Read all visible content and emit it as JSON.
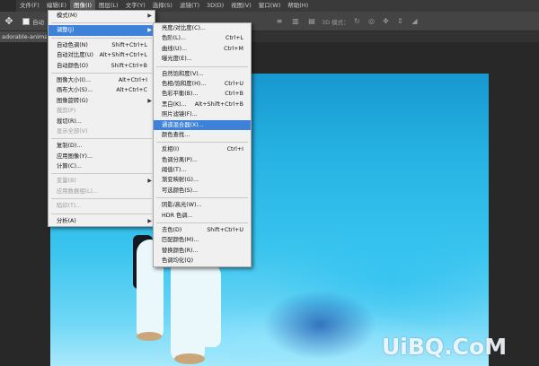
{
  "menubar": {
    "items": [
      "文件(F)",
      "编辑(E)",
      "图像(I)",
      "图层(L)",
      "文字(Y)",
      "选择(S)",
      "滤镜(T)",
      "3D(D)",
      "视图(V)",
      "窗口(W)",
      "帮助(H)"
    ]
  },
  "optbar": {
    "checkbox_label": "自动",
    "mode_label": "3D 模式："
  },
  "document": {
    "tab_title": "adorable-animal-"
  },
  "image_menu": {
    "items": [
      {
        "label": "模式(M)",
        "shortcut": "",
        "submenu": true,
        "disabled": false
      },
      {
        "sep": true
      },
      {
        "label": "调整(J)",
        "shortcut": "",
        "submenu": true,
        "disabled": false,
        "highlighted": true
      },
      {
        "sep": true
      },
      {
        "label": "自动色调(N)",
        "shortcut": "Shift+Ctrl+L",
        "disabled": false
      },
      {
        "label": "自动对比度(U)",
        "shortcut": "Alt+Shift+Ctrl+L",
        "disabled": false
      },
      {
        "label": "自动颜色(O)",
        "shortcut": "Shift+Ctrl+B",
        "disabled": false
      },
      {
        "sep": true
      },
      {
        "label": "图像大小(I)...",
        "shortcut": "Alt+Ctrl+I",
        "disabled": false
      },
      {
        "label": "画布大小(S)...",
        "shortcut": "Alt+Ctrl+C",
        "disabled": false
      },
      {
        "label": "图像旋转(G)",
        "shortcut": "",
        "submenu": true,
        "disabled": false
      },
      {
        "label": "裁剪(P)",
        "shortcut": "",
        "disabled": true
      },
      {
        "label": "裁切(R)...",
        "shortcut": "",
        "disabled": false
      },
      {
        "label": "显示全部(V)",
        "shortcut": "",
        "disabled": true
      },
      {
        "sep": true
      },
      {
        "label": "复制(D)...",
        "shortcut": "",
        "disabled": false
      },
      {
        "label": "应用图像(Y)...",
        "shortcut": "",
        "disabled": false
      },
      {
        "label": "计算(C)...",
        "shortcut": "",
        "disabled": false
      },
      {
        "sep": true
      },
      {
        "label": "变量(B)",
        "shortcut": "",
        "submenu": true,
        "disabled": true
      },
      {
        "label": "应用数据组(L)...",
        "shortcut": "",
        "disabled": true
      },
      {
        "sep": true
      },
      {
        "label": "陷印(T)...",
        "shortcut": "",
        "disabled": true
      },
      {
        "sep": true
      },
      {
        "label": "分析(A)",
        "shortcut": "",
        "submenu": true,
        "disabled": false
      }
    ]
  },
  "adjust_menu": {
    "items": [
      {
        "label": "亮度/对比度(C)...",
        "shortcut": ""
      },
      {
        "label": "色阶(L)...",
        "shortcut": "Ctrl+L"
      },
      {
        "label": "曲线(U)...",
        "shortcut": "Ctrl+M"
      },
      {
        "label": "曝光度(E)...",
        "shortcut": ""
      },
      {
        "sep": true
      },
      {
        "label": "自然饱和度(V)...",
        "shortcut": ""
      },
      {
        "label": "色相/饱和度(H)...",
        "shortcut": "Ctrl+U"
      },
      {
        "label": "色彩平衡(B)...",
        "shortcut": "Ctrl+B"
      },
      {
        "label": "黑白(K)...",
        "shortcut": "Alt+Shift+Ctrl+B"
      },
      {
        "label": "照片滤镜(F)...",
        "shortcut": ""
      },
      {
        "label": "通道混合器(X)...",
        "shortcut": "",
        "highlighted": true
      },
      {
        "label": "颜色查找...",
        "shortcut": ""
      },
      {
        "sep": true
      },
      {
        "label": "反相(I)",
        "shortcut": "Ctrl+I"
      },
      {
        "label": "色调分离(P)...",
        "shortcut": ""
      },
      {
        "label": "阈值(T)...",
        "shortcut": ""
      },
      {
        "label": "渐变映射(G)...",
        "shortcut": ""
      },
      {
        "label": "可选颜色(S)...",
        "shortcut": ""
      },
      {
        "sep": true
      },
      {
        "label": "阴影/高光(W)...",
        "shortcut": ""
      },
      {
        "label": "HDR 色调...",
        "shortcut": ""
      },
      {
        "sep": true
      },
      {
        "label": "去色(D)",
        "shortcut": "Shift+Ctrl+U"
      },
      {
        "label": "匹配颜色(M)...",
        "shortcut": ""
      },
      {
        "label": "替换颜色(R)...",
        "shortcut": ""
      },
      {
        "label": "色调均化(Q)",
        "shortcut": ""
      }
    ]
  },
  "watermark": {
    "text": "UiBQ.CoM"
  },
  "colors": {
    "menu_bg": "#f0f0f0",
    "highlight": "#3d82d8",
    "workspace": "#282828"
  }
}
